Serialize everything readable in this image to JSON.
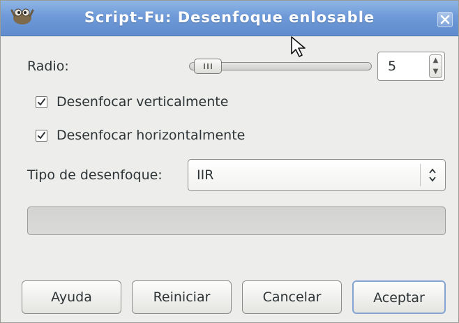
{
  "window": {
    "title": "Script-Fu: Desenfoque enlosable",
    "close_icon": "close-icon",
    "app_icon": "gimp-wilber-icon"
  },
  "radius": {
    "label": "Radio:",
    "value": "5",
    "slider_fraction": 0.05
  },
  "options": {
    "vertical_label": "Desenfocar verticalmente",
    "vertical_checked": true,
    "horizontal_label": "Desenfocar horizontalmente",
    "horizontal_checked": true
  },
  "blur_type": {
    "label": "Tipo de desenfoque:",
    "value": "IIR"
  },
  "buttons": {
    "help": "Ayuda",
    "reset": "Reiniciar",
    "cancel": "Cancelar",
    "ok": "Aceptar"
  },
  "colors": {
    "titlebar": "#6e9ad8",
    "default_button_border": "#84a3d2"
  }
}
